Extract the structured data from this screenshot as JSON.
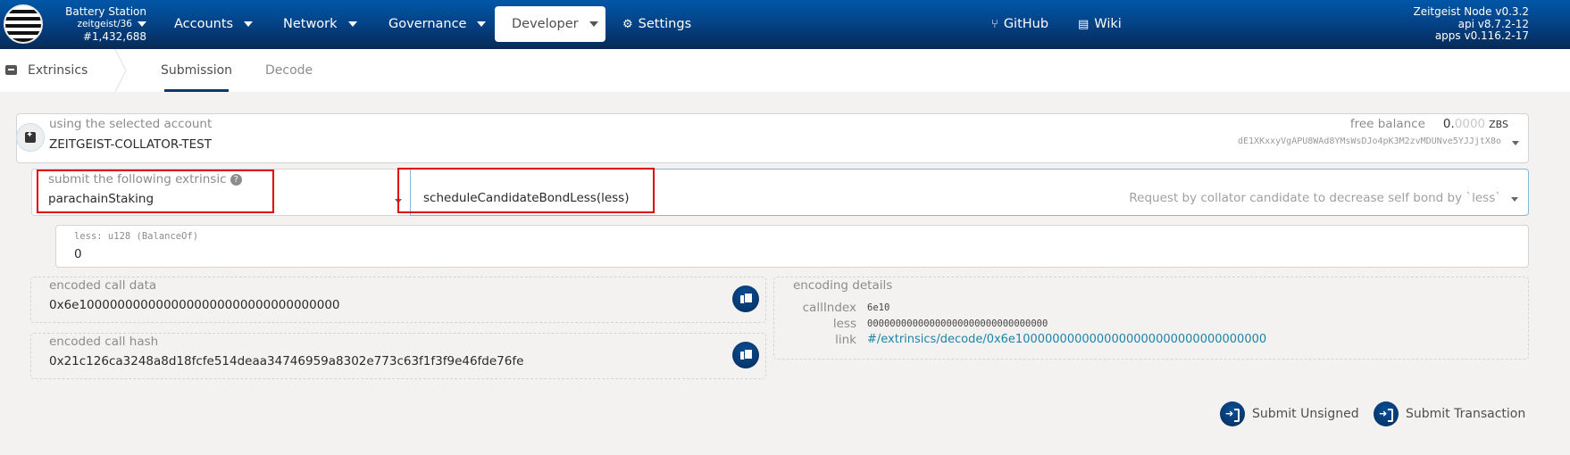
{
  "header": {
    "chain_name": "Battery Station",
    "spec": "zeitgeist/36",
    "block": "#1,432,688",
    "nav": [
      {
        "label": "Accounts",
        "has_dropdown": true
      },
      {
        "label": "Network",
        "has_dropdown": true
      },
      {
        "label": "Governance",
        "has_dropdown": true
      },
      {
        "label": "Developer",
        "has_dropdown": true,
        "active": true
      },
      {
        "label": "Settings",
        "icon": "gears-icon"
      }
    ],
    "links": [
      {
        "label": "GitHub",
        "icon": "code-branch-icon"
      },
      {
        "label": "Wiki",
        "icon": "book-icon"
      }
    ],
    "node_info": {
      "node": "Zeitgeist Node v0.3.2",
      "api": "api v8.7.2-12",
      "apps": "apps v0.116.2-17"
    }
  },
  "subnav": {
    "section": "Extrinsics",
    "tabs": [
      {
        "label": "Submission",
        "active": true
      },
      {
        "label": "Decode",
        "active": false
      }
    ]
  },
  "account": {
    "label": "using the selected account",
    "name": "ZEITGEIST-COLLATOR-TEST",
    "free_balance_label": "free balance",
    "balance_int": "0.",
    "balance_dec": "0000",
    "unit": "ZBS",
    "address": "dE1XKxxyVgAPU8WAd8YMsWsDJo4pK3M2zvMDUNve5YJJjtX8o"
  },
  "extrinsic": {
    "label": "submit the following extrinsic",
    "pallet": "parachainStaking",
    "method": "scheduleCandidateBondLess(less)",
    "description": "Request by collator candidate to decrease self bond by `less`"
  },
  "param": {
    "label": "less: u128 (BalanceOf)",
    "value": "0"
  },
  "encoded_call_data": {
    "label": "encoded call data",
    "value": "0x6e1000000000000000000000000000000000"
  },
  "encoded_call_hash": {
    "label": "encoded call hash",
    "value": "0x21c126ca3248a8d18fcfe514deaa34746959a8302e773c63f1f3f9e46fde76fe"
  },
  "encoding_details": {
    "label": "encoding details",
    "rows": [
      {
        "key": "callIndex",
        "value": "6e10"
      },
      {
        "key": "less",
        "value": "00000000000000000000000000000000"
      },
      {
        "key": "link",
        "value": "#/extrinsics/decode/0x6e1000000000000000000000000000000000"
      }
    ]
  },
  "actions": {
    "submit_unsigned": "Submit Unsigned",
    "submit_transaction": "Submit Transaction"
  },
  "colors": {
    "header_top": "#0157a8",
    "header_bottom": "#062a57",
    "button": "#0a4f97",
    "link": "#1a85a8",
    "highlight": "#e00000"
  }
}
